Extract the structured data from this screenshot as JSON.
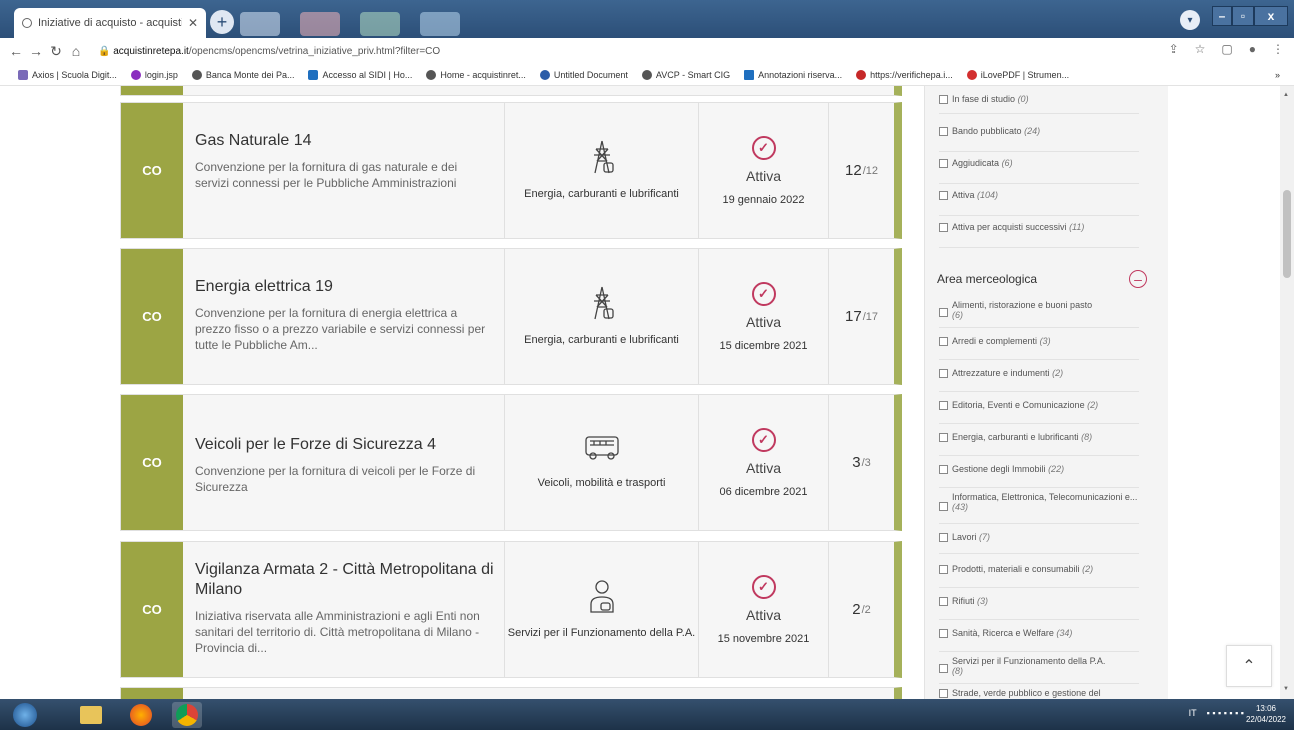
{
  "browser": {
    "tab_title": "Iniziative di acquisto - acquistinr",
    "url_domain": "acquistinretepa.it",
    "url_path": "/opencms/opencms/vetrina_iniziative_priv.html?filter=CO",
    "bookmarks": [
      "Axios | Scuola Digit...",
      "login.jsp",
      "Banca Monte dei Pa...",
      "Accesso al SIDI | Ho...",
      "Home - acquistinret...",
      "Untitled Document",
      "AVCP - Smart CIG",
      "Annotazioni riserva...",
      "https://verifichepa.i...",
      "iLovePDF | Strumen..."
    ],
    "bookmarks_more": "»"
  },
  "cards": [
    {
      "badge": "CO",
      "title": "Gas Naturale 14",
      "description": "Convenzione per la fornitura di gas naturale e dei servizi connessi per le Pubbliche Amministrazioni",
      "category": "Energia, carburanti e lubrificanti",
      "category_icon": "power-pylon-icon",
      "status": "Attiva",
      "date": "19 gennaio 2022",
      "count": "12",
      "count_total": "/12"
    },
    {
      "badge": "CO",
      "title": "Energia elettrica 19",
      "description": "Convenzione per la fornitura di energia elettrica a prezzo fisso o a prezzo variabile e servizi connessi per tutte le Pubbliche Am...",
      "category": "Energia, carburanti e lubrificanti",
      "category_icon": "power-pylon-icon",
      "status": "Attiva",
      "date": "15 dicembre 2021",
      "count": "17",
      "count_total": "/17"
    },
    {
      "badge": "CO",
      "title": "Veicoli per le Forze di Sicurezza 4",
      "description": "Convenzione per la fornitura di veicoli per le Forze di Sicurezza",
      "category": "Veicoli, mobilità e trasporti",
      "category_icon": "bus-icon",
      "status": "Attiva",
      "date": "06 dicembre 2021",
      "count": "3",
      "count_total": "/3"
    },
    {
      "badge": "CO",
      "title": "Vigilanza Armata 2 - Città Metropolitana di Milano",
      "description": "Iniziativa riservata alle Amministrazioni e agli Enti non sanitari del territorio di. Città metropolitana di Milano - Provincia di...",
      "category": "Servizi per il Funzionamento della P.A.",
      "category_icon": "person-service-icon",
      "status": "Attiva",
      "date": "15 novembre 2021",
      "count": "2",
      "count_total": "/2"
    }
  ],
  "sidebar": {
    "status_filters": [
      {
        "label": "In fase di studio",
        "count": "(0)"
      },
      {
        "label": "Bando pubblicato",
        "count": "(24)"
      },
      {
        "label": "Aggiudicata",
        "count": "(6)"
      },
      {
        "label": "Attiva",
        "count": "(104)"
      },
      {
        "label": "Attiva per acquisti successivi",
        "count": "(11)"
      }
    ],
    "area_title": "Area merceologica",
    "area_filters": [
      {
        "label": "Alimenti, ristorazione e buoni pasto",
        "count": "(6)"
      },
      {
        "label": "Arredi e complementi",
        "count": "(3)"
      },
      {
        "label": "Attrezzature e indumenti",
        "count": "(2)"
      },
      {
        "label": "Editoria, Eventi e Comunicazione",
        "count": "(2)"
      },
      {
        "label": "Energia, carburanti e lubrificanti",
        "count": "(8)"
      },
      {
        "label": "Gestione degli Immobili",
        "count": "(22)"
      },
      {
        "label": "Informatica, Elettronica, Telecomunicazioni e...",
        "count": "(43)"
      },
      {
        "label": "Lavori",
        "count": "(7)"
      },
      {
        "label": "Prodotti, materiali e consumabili",
        "count": "(2)"
      },
      {
        "label": "Rifiuti",
        "count": "(3)"
      },
      {
        "label": "Sanità, Ricerca e Welfare",
        "count": "(34)"
      },
      {
        "label": "Servizi per il Funzionamento della P.A.",
        "count": "(8)"
      },
      {
        "label": "Strade, verde pubblico e gestione del",
        "count": ""
      }
    ]
  },
  "taskbar": {
    "lang": "IT",
    "time": "13:06",
    "date": "22/04/2022"
  },
  "colors": {
    "badge_green": "#9ca544",
    "accent_magenta": "#c0395f",
    "titlebar_blue": "#2c4f78"
  }
}
